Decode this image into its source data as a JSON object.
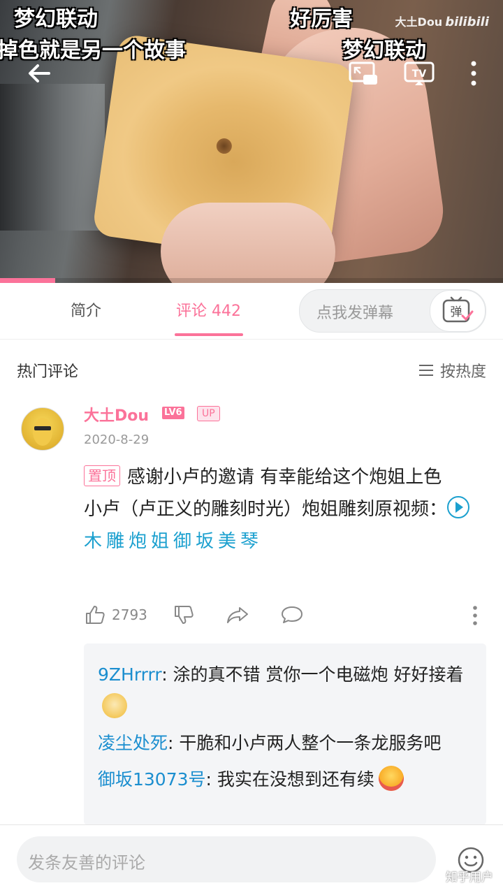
{
  "video": {
    "danmaku": [
      {
        "text": "梦幻联动",
        "pos": "tl"
      },
      {
        "text": "好厉害",
        "pos": "tc"
      },
      {
        "text": "掉色就是另一个故事",
        "pos": "ml"
      },
      {
        "text": "梦幻联动",
        "pos": "mr"
      }
    ],
    "watermark_user": "大土Dou",
    "watermark_brand": "bilibili",
    "progress_fraction": 0.11
  },
  "tabs": {
    "intro": "简介",
    "comments": "评论 442",
    "danmaku_placeholder": "点我发弹幕",
    "danmaku_button": "弹"
  },
  "comments_section": {
    "heading": "热门评论",
    "sort_label": "按热度"
  },
  "comment": {
    "username": "大土Dou",
    "level": "LV6",
    "badge": "UP",
    "date": "2020-8-29",
    "pin_label": "置顶",
    "line1": "感谢小卢的邀请 有幸能给这个炮姐上色",
    "line2": "小卢（卢正义的雕刻时光）炮姐雕刻原视频：",
    "video_link": "木雕炮姐御坂美琴",
    "likes": "2793"
  },
  "replies": [
    {
      "user": "9ZHrrrr",
      "text": ": 涂的真不错 赏你一个电磁炮 好好接着",
      "emoji": "doge-emoji"
    },
    {
      "user": "凌尘处死",
      "text": ": 干脆和小卢两人整个一条龙服务吧",
      "emoji": ""
    },
    {
      "user": "御坂13073号",
      "text": ": 我实在没想到还有续",
      "emoji": "drool-emoji"
    }
  ],
  "bottom": {
    "placeholder": "发条友善的评论",
    "watermark": "知乎用户"
  },
  "colors": {
    "accent": "#fb7299",
    "link": "#1ba0cf"
  }
}
